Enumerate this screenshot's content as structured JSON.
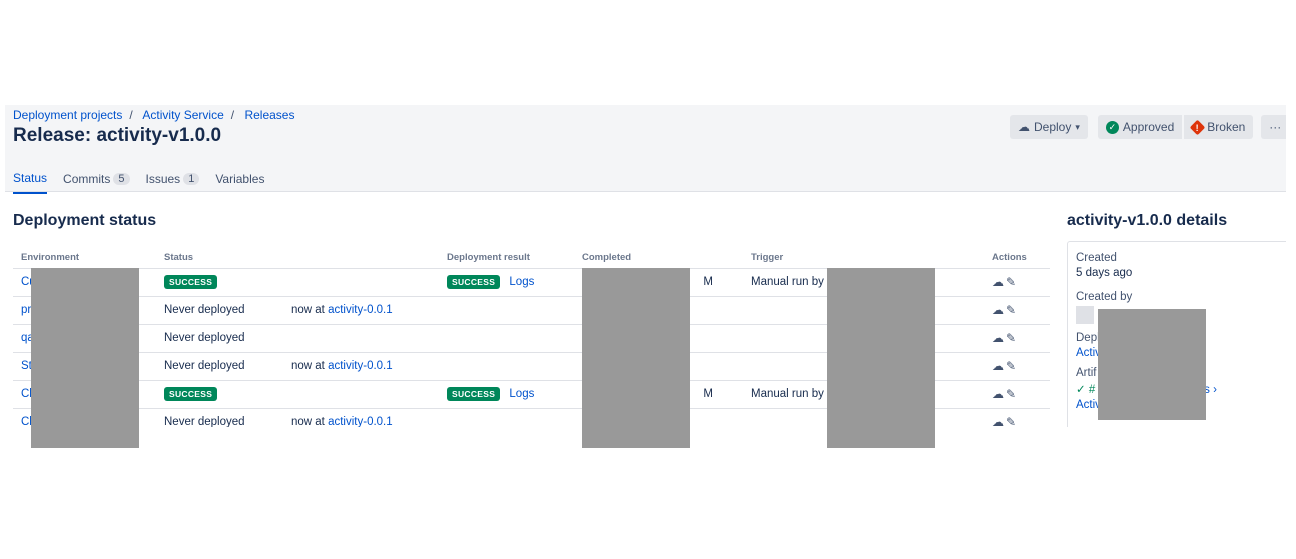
{
  "breadcrumbs": [
    "Deployment projects",
    "Activity Service",
    "Releases"
  ],
  "title": "Release: activity-v1.0.0",
  "tabs": [
    {
      "label": "Status",
      "count": null
    },
    {
      "label": "Commits",
      "count": "5"
    },
    {
      "label": "Issues",
      "count": "1"
    },
    {
      "label": "Variables",
      "count": null
    }
  ],
  "actions": {
    "deploy": "Deploy",
    "approved": "Approved",
    "broken": "Broken",
    "more": "···"
  },
  "deployment_status": {
    "heading": "Deployment status",
    "columns": [
      "Environment",
      "Status",
      "",
      "Deployment result",
      "Completed",
      "Trigger",
      "Actions"
    ],
    "rows": [
      {
        "env": "Cu",
        "status": "SUCCESS",
        "now_at_label": "",
        "now_at": "",
        "result": "SUCCESS",
        "logs": "Logs",
        "completed": "M",
        "trigger": "Manual run by"
      },
      {
        "env": "pr",
        "status": "Never deployed",
        "now_at_label": "now at",
        "now_at": "activity-0.0.1",
        "result": "",
        "logs": "",
        "completed": "",
        "trigger": ""
      },
      {
        "env": "qa",
        "status": "Never deployed",
        "now_at_label": "",
        "now_at": "",
        "result": "",
        "logs": "",
        "completed": "",
        "trigger": ""
      },
      {
        "env": "St",
        "status": "Never deployed",
        "now_at_label": "now at",
        "now_at": "activity-0.0.1",
        "result": "",
        "logs": "",
        "completed": "",
        "trigger": ""
      },
      {
        "env": "Ch",
        "status": "SUCCESS",
        "now_at_label": "",
        "now_at": "",
        "result": "SUCCESS",
        "logs": "Logs",
        "completed": "M",
        "trigger": "Manual run by"
      },
      {
        "env": "Ch",
        "status": "Never deployed",
        "now_at_label": "now at",
        "now_at": "activity-0.0.1",
        "result": "",
        "logs": "",
        "completed": "",
        "trigger": ""
      }
    ]
  },
  "details": {
    "heading": "activity-v1.0.0 details",
    "created_label": "Created",
    "created": "5 days ago",
    "created_by_label": "Created by",
    "deploy_label": "Depl",
    "deploy_value": "Activ",
    "artifacts_label": "Artif",
    "artifact_hash": "#",
    "artifact_link": "ations ›",
    "artifact_value": "Activ"
  },
  "colors": {
    "accent": "#0052cc",
    "success": "#00875a",
    "broken": "#de350b",
    "header_bg": "#f4f5f7"
  }
}
